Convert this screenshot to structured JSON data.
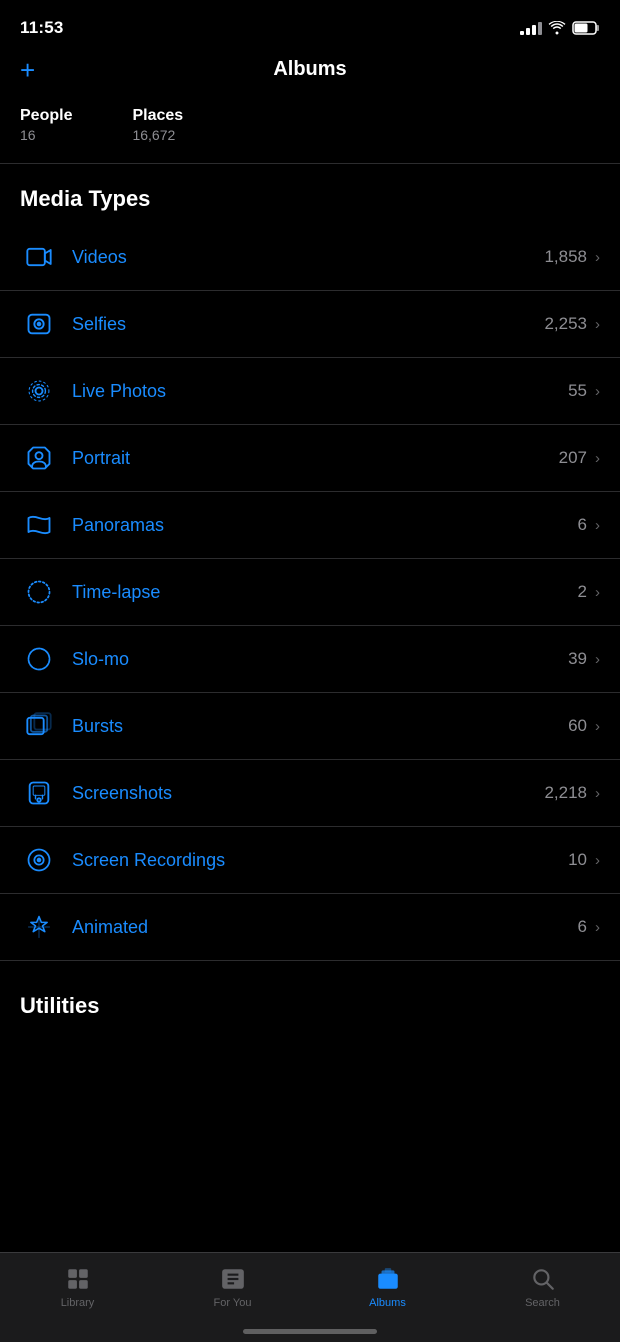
{
  "statusBar": {
    "time": "11:53",
    "signalBars": 3,
    "wifi": true,
    "battery": 60
  },
  "header": {
    "addButton": "+",
    "title": "Albums"
  },
  "peoplePlaces": [
    {
      "label": "People",
      "count": "16"
    },
    {
      "label": "Places",
      "count": "16,672"
    }
  ],
  "sections": [
    {
      "id": "media-types",
      "title": "Media Types",
      "items": [
        {
          "id": "videos",
          "name": "Videos",
          "count": "1,858",
          "icon": "video"
        },
        {
          "id": "selfies",
          "name": "Selfies",
          "count": "2,253",
          "icon": "selfie"
        },
        {
          "id": "live-photos",
          "name": "Live Photos",
          "count": "55",
          "icon": "live"
        },
        {
          "id": "portrait",
          "name": "Portrait",
          "count": "207",
          "icon": "portrait"
        },
        {
          "id": "panoramas",
          "name": "Panoramas",
          "count": "6",
          "icon": "panorama"
        },
        {
          "id": "time-lapse",
          "name": "Time-lapse",
          "count": "2",
          "icon": "timelapse"
        },
        {
          "id": "slo-mo",
          "name": "Slo-mo",
          "count": "39",
          "icon": "slomo"
        },
        {
          "id": "bursts",
          "name": "Bursts",
          "count": "60",
          "icon": "bursts"
        },
        {
          "id": "screenshots",
          "name": "Screenshots",
          "count": "2,218",
          "icon": "screenshots"
        },
        {
          "id": "screen-recordings",
          "name": "Screen Recordings",
          "count": "10",
          "icon": "screenrecord"
        },
        {
          "id": "animated",
          "name": "Animated",
          "count": "6",
          "icon": "animated"
        }
      ]
    },
    {
      "id": "utilities",
      "title": "Utilities",
      "items": []
    }
  ],
  "tabBar": {
    "items": [
      {
        "id": "library",
        "label": "Library",
        "icon": "library",
        "active": false
      },
      {
        "id": "for-you",
        "label": "For You",
        "icon": "foryou",
        "active": false
      },
      {
        "id": "albums",
        "label": "Albums",
        "icon": "albums",
        "active": true
      },
      {
        "id": "search",
        "label": "Search",
        "icon": "search",
        "active": false
      }
    ]
  }
}
